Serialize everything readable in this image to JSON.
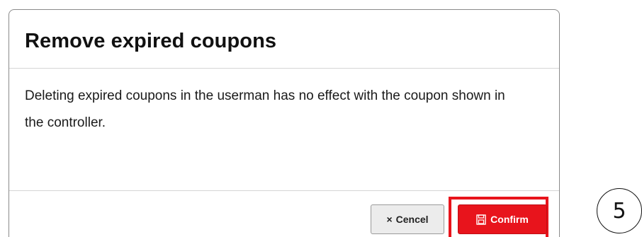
{
  "dialog": {
    "title": "Remove expired coupons",
    "message": "Deleting expired coupons in the userman has no effect with the coupon shown in the controller.",
    "cancel_icon": "×",
    "cancel_label": "Cencel",
    "confirm_icon": "save-icon",
    "confirm_label": "Confirm"
  },
  "step_badge": "5",
  "colors": {
    "accent": "#e8141c",
    "highlight": "#e8141c",
    "cancel_bg": "#ececec"
  }
}
